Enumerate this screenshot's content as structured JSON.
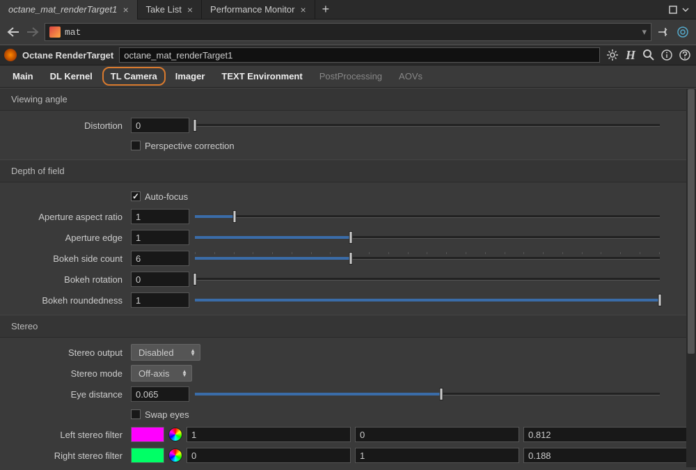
{
  "tabs": {
    "items": [
      {
        "label": "octane_mat_renderTarget1",
        "active": true
      },
      {
        "label": "Take List",
        "active": false
      },
      {
        "label": "Performance Monitor",
        "active": false
      }
    ]
  },
  "nav": {
    "path": "mat"
  },
  "node": {
    "type": "Octane RenderTarget",
    "name": "octane_mat_renderTarget1"
  },
  "param_tabs": {
    "items": [
      {
        "label": "Main",
        "active": false,
        "dim": false
      },
      {
        "label": "DL Kernel",
        "active": false,
        "dim": false
      },
      {
        "label": "TL Camera",
        "active": true,
        "dim": false
      },
      {
        "label": "Imager",
        "active": false,
        "dim": false
      },
      {
        "label": "TEXT Environment",
        "active": false,
        "dim": false
      },
      {
        "label": "PostProcessing",
        "active": false,
        "dim": true
      },
      {
        "label": "AOVs",
        "active": false,
        "dim": true
      }
    ]
  },
  "sections": {
    "viewing": {
      "title": "Viewing angle",
      "distortion": {
        "label": "Distortion",
        "value": "0",
        "pos": 0
      },
      "persp": {
        "label": "Perspective correction",
        "checked": false
      }
    },
    "dof": {
      "title": "Depth of field",
      "autofocus": {
        "label": "Auto-focus",
        "checked": true
      },
      "aspect": {
        "label": "Aperture aspect ratio",
        "value": "1",
        "pos": 8.5
      },
      "edge": {
        "label": "Aperture edge",
        "value": "1",
        "pos": 33.5
      },
      "sides": {
        "label": "Bokeh side count",
        "value": "6",
        "pos": 33.5,
        "ticks": true
      },
      "rotation": {
        "label": "Bokeh rotation",
        "value": "0",
        "pos": 0
      },
      "roundedness": {
        "label": "Bokeh roundedness",
        "value": "1",
        "pos": 100
      }
    },
    "stereo": {
      "title": "Stereo",
      "output": {
        "label": "Stereo output",
        "value": "Disabled"
      },
      "mode": {
        "label": "Stereo mode",
        "value": "Off-axis"
      },
      "eyedist": {
        "label": "Eye distance",
        "value": "0.065",
        "pos": 53
      },
      "swap": {
        "label": "Swap eyes",
        "checked": false
      },
      "left": {
        "label": "Left stereo filter",
        "color": "#ff00ff",
        "r": "1",
        "g": "0",
        "b": "0.812"
      },
      "right": {
        "label": "Right stereo filter",
        "color": "#00ff66",
        "r": "0",
        "g": "1",
        "b": "0.188"
      }
    }
  }
}
